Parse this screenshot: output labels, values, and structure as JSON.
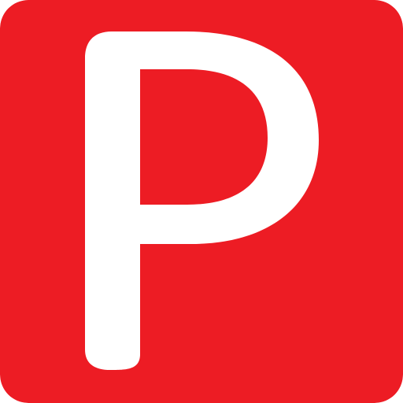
{
  "icon": {
    "name": "parking-icon",
    "glyph": "P",
    "background_color": "#ed1c24",
    "glyph_color": "#ffffff"
  }
}
